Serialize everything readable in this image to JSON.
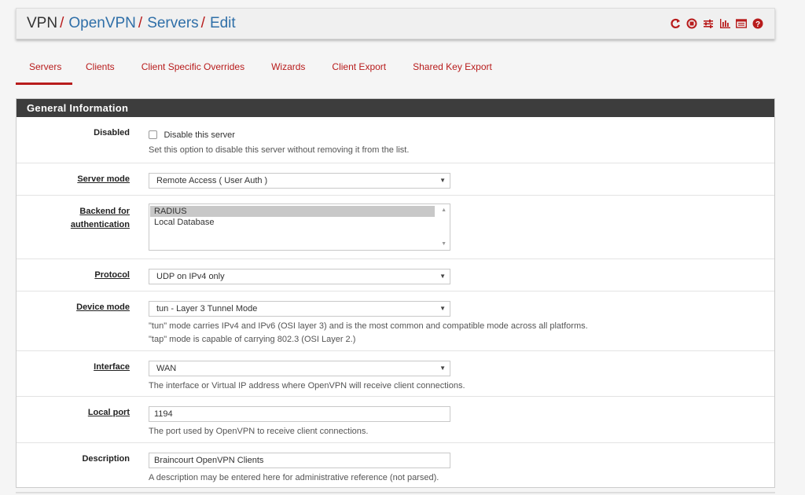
{
  "breadcrumb": {
    "root": "VPN",
    "items": [
      "OpenVPN",
      "Servers",
      "Edit"
    ],
    "separator": "/"
  },
  "header_icons": [
    "reload-icon",
    "stop-icon",
    "sliders-icon",
    "chart-icon",
    "log-icon",
    "help-icon"
  ],
  "tabs": [
    {
      "label": "Servers",
      "active": true
    },
    {
      "label": "Clients",
      "active": false
    },
    {
      "label": "Client Specific Overrides",
      "active": false
    },
    {
      "label": "Wizards",
      "active": false
    },
    {
      "label": "Client Export",
      "active": false
    },
    {
      "label": "Shared Key Export",
      "active": false
    }
  ],
  "panel": {
    "title": "General Information",
    "disabled": {
      "label": "Disabled",
      "checkbox_label": "Disable this server",
      "checked": false,
      "help": "Set this option to disable this server without removing it from the list."
    },
    "server_mode": {
      "label": "Server mode",
      "value": "Remote Access ( User Auth )"
    },
    "backend_auth": {
      "label_line1": "Backend for",
      "label_line2": "authentication",
      "options": [
        "RADIUS",
        "Local Database"
      ],
      "selected": "RADIUS"
    },
    "protocol": {
      "label": "Protocol",
      "value": "UDP on IPv4 only"
    },
    "device_mode": {
      "label": "Device mode",
      "value": "tun - Layer 3 Tunnel Mode",
      "help1": "\"tun\" mode carries IPv4 and IPv6 (OSI layer 3) and is the most common and compatible mode across all platforms.",
      "help2": "\"tap\" mode is capable of carrying 802.3 (OSI Layer 2.)"
    },
    "interface": {
      "label": "Interface",
      "value": "WAN",
      "help": "The interface or Virtual IP address where OpenVPN will receive client connections."
    },
    "local_port": {
      "label": "Local port",
      "value": "1194",
      "help": "The port used by OpenVPN to receive client connections."
    },
    "description": {
      "label": "Description",
      "value": "Braincourt OpenVPN Clients",
      "help": "A description may be entered here for administrative reference (not parsed)."
    }
  },
  "colors": {
    "accent_red": "#b81c1c",
    "link_blue": "#2f6fa8",
    "panel_heading": "#3d3d3d"
  }
}
